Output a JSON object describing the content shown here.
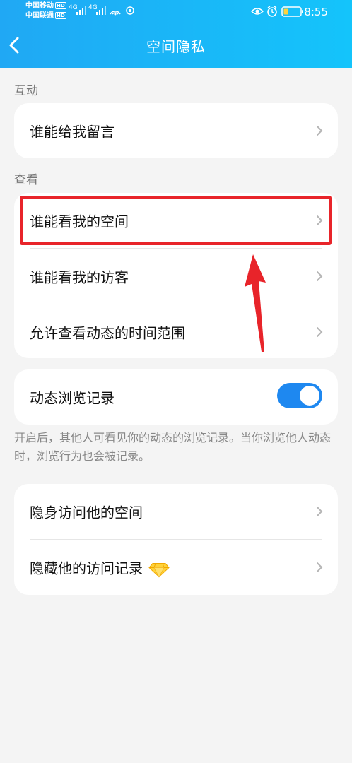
{
  "status_bar": {
    "carrier_1": "中国移动",
    "carrier_2": "中国联通",
    "hd_badge": "HD",
    "network_1": "4G",
    "network_2": "4G",
    "time": "8:55"
  },
  "nav": {
    "title": "空间隐私"
  },
  "sections": {
    "interaction_label": "互动",
    "view_label": "查看"
  },
  "interaction": {
    "who_can_message": "谁能给我留言"
  },
  "view": {
    "who_can_see_space": "谁能看我的空间",
    "who_can_see_visitors": "谁能看我的访客",
    "allowed_time_range": "允许查看动态的时间范围"
  },
  "browse_record": {
    "label": "动态浏览记录",
    "enabled": true,
    "note": "开启后，其他人可看见你的动态的浏览记录。当你浏览他人动态时，浏览行为也会被记录。"
  },
  "stealth": {
    "invisible_visit": "隐身访问他的空间",
    "hide_visit_record": "隐藏他的访问记录"
  },
  "colors": {
    "header_start": "#20a8f4",
    "header_end": "#14c4fb",
    "toggle_on": "#1e88f0",
    "annotation_red": "#e8242a"
  }
}
